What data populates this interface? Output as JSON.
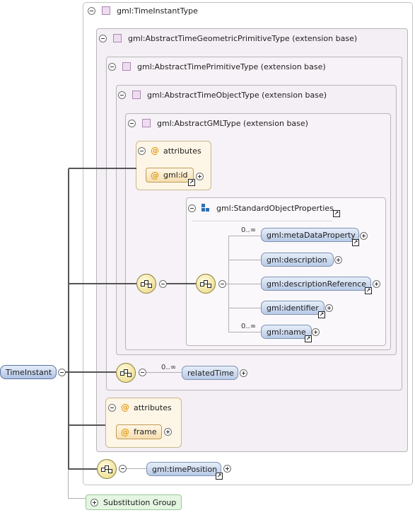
{
  "root": {
    "label": "TimeInstant"
  },
  "groups": {
    "time_instant_type": "gml:TimeInstantType",
    "abstract_geometric": "gml:AbstractTimeGeometricPrimitiveType (extension base)",
    "abstract_primitive": "gml:AbstractTimePrimitiveType (extension base)",
    "abstract_object": "gml:AbstractTimeObjectType (extension base)",
    "abstract_gml": "gml:AbstractGMLType (extension base)",
    "standard_props": "gml:StandardObjectProperties"
  },
  "attributes": {
    "header": "attributes",
    "gml_id": "gml:id",
    "header2": "attributes",
    "frame": "frame"
  },
  "elements": {
    "meta_data_property": "gml:metaDataProperty",
    "description": "gml:description",
    "description_reference": "gml:descriptionReference",
    "identifier": "gml:identifier",
    "name": "gml:name",
    "related_time": "relatedTime",
    "time_position": "gml:timePosition"
  },
  "cardinality": {
    "meta_data_property": "0..∞",
    "name": "0..∞",
    "related_time": "0..∞"
  },
  "substitution_group": "Substitution Group",
  "symbols": {
    "attribute_marker": "@",
    "ref_arrow": "↗"
  },
  "colors": {
    "element_fill": "#c9d8f0",
    "attribute_fill": "#fdf6e6",
    "type_square": "#efdcf1",
    "substitution_fill": "#e4f6e2",
    "connector": "#555555"
  }
}
